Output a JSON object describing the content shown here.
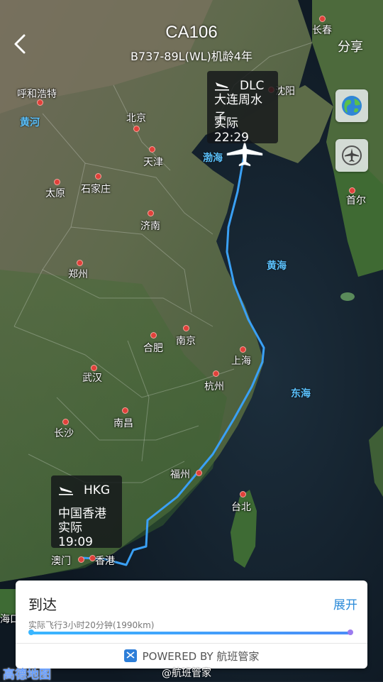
{
  "header": {
    "flight_number": "CA106",
    "aircraft_info": "B737-89L(WL)机龄4年",
    "back_icon": "chevron-left-icon",
    "share_label": "分享"
  },
  "map_buttons": [
    {
      "name": "globe-button",
      "icon": "globe-icon"
    },
    {
      "name": "airplane-button",
      "icon": "airplane-icon"
    }
  ],
  "arrival_airport": {
    "code": "DLC",
    "name": "大连周水子",
    "time_label": "实际 22:29",
    "icon": "airplane-landing-icon"
  },
  "departure_airport": {
    "code": "HKG",
    "name": "中国香港",
    "time_label": "实际 19:09",
    "icon": "airplane-landing-icon"
  },
  "map": {
    "cities": [
      "长春",
      "呼和浩特",
      "沈阳",
      "北京",
      "天津",
      "首尔",
      "太原",
      "石家庄",
      "济南",
      "郑州",
      "南京",
      "合肥",
      "上海",
      "武汉",
      "杭州",
      "南昌",
      "长沙",
      "福州",
      "台北",
      "澳门",
      "香港",
      "海口"
    ],
    "seas": [
      "黄河",
      "渤海",
      "黄海",
      "东海"
    ],
    "route_color": "#3aa0f5",
    "city_dot_color": "#e0413a"
  },
  "panel": {
    "status": "到达",
    "expand_label": "展开",
    "duration_text": "实际飞行3小时20分钟(1990km)",
    "progress": 1.0,
    "powered_by": "POWERED BY 航班管家"
  },
  "watermarks": {
    "left": "高德地图",
    "right": "@航班管家"
  }
}
